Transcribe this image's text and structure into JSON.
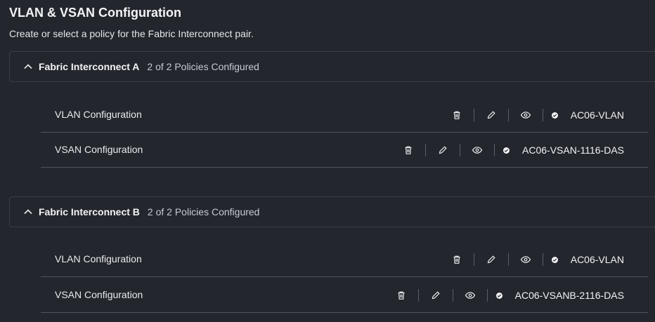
{
  "page": {
    "title": "VLAN & VSAN Configuration",
    "subtitle": "Create or select a policy for the Fabric Interconnect pair."
  },
  "sections": [
    {
      "title": "Fabric Interconnect A",
      "status": "2 of 2 Policies Configured",
      "rows": [
        {
          "label": "VLAN Configuration",
          "policy": "AC06-VLAN"
        },
        {
          "label": "VSAN Configuration",
          "policy": "AC06-VSAN-1116-DAS"
        }
      ]
    },
    {
      "title": "Fabric Interconnect B",
      "status": "2 of 2 Policies Configured",
      "rows": [
        {
          "label": "VLAN Configuration",
          "policy": "AC06-VLAN"
        },
        {
          "label": "VSAN Configuration",
          "policy": "AC06-VSANB-2116-DAS"
        }
      ]
    }
  ],
  "icons": {
    "collapse": "chevron-up-icon",
    "delete": "trash-icon",
    "edit": "pencil-icon",
    "view": "eye-icon",
    "status": "check-circle-icon"
  },
  "colors": {
    "background": "#23262d",
    "border": "#3a3e46",
    "divider": "#50545c",
    "text": "#e9ebee"
  }
}
